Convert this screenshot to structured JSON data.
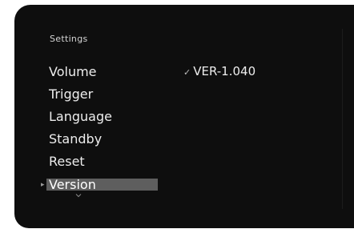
{
  "panel": {
    "title": "Settings"
  },
  "menu": {
    "items": [
      {
        "label": "Volume"
      },
      {
        "label": "Trigger"
      },
      {
        "label": "Language"
      },
      {
        "label": "Standby"
      },
      {
        "label": "Reset"
      },
      {
        "label": "Version"
      }
    ],
    "selected": "Version"
  },
  "detail": {
    "check_glyph": "✓",
    "value": "VER-1.040"
  },
  "icons": {
    "pointer": "pointer-arrow-icon",
    "chevron": "chevron-down-icon",
    "check": "check-icon"
  },
  "colors": {
    "background": "#0e0e0e",
    "text": "#ededed",
    "highlight": "#5e5e5e"
  }
}
